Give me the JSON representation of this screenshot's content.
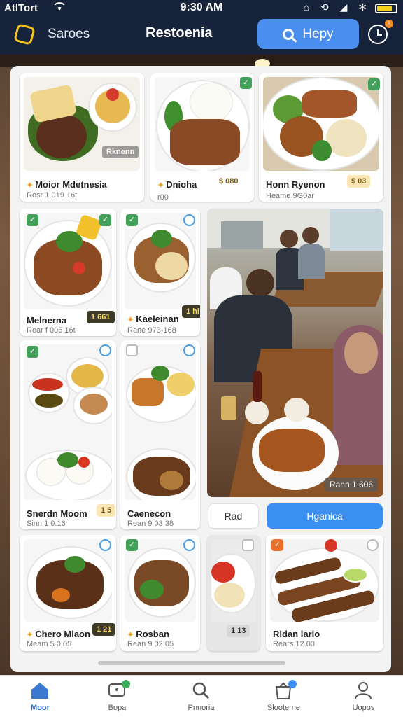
{
  "status": {
    "carrier": "AtlTort",
    "time": "9:30 AM",
    "battery_level": 0.8
  },
  "header": {
    "back_label": "Saroes",
    "title": "Restoenia",
    "help_label": "Hepy",
    "notification_count": "1"
  },
  "colors": {
    "accent": "#3b8ff0",
    "header_bg": "#17233a",
    "check_green": "#42a05a",
    "price_gold": "#f2d76b"
  },
  "cards": [
    {
      "name": "Moior Mdetnesia",
      "meta": "Rosr 1 019 16t",
      "tag": "Rknenn"
    },
    {
      "name": "Dnioha",
      "meta": "r00",
      "tag": "$ 080"
    },
    {
      "name": "Honn Ryenon",
      "meta": "Heame 9G0ar",
      "tag": "$ 03"
    },
    {
      "name": "Melnerna",
      "meta": "Rear f 005 16t",
      "tag": "1 661"
    },
    {
      "name": "Kaeleinan",
      "meta": "Rane 973-168",
      "tag": "1 hi"
    },
    {
      "name": "Snerdn Moom",
      "meta": "Sinn 1 0.16",
      "tag": "1 5"
    },
    {
      "name": "Caenecon",
      "meta": "Rean 9 03 38",
      "tag": ""
    },
    {
      "name": "Chero Mlaon",
      "meta": "Meam 5 0.05",
      "tag": "1 21"
    },
    {
      "name": "Rosban",
      "meta": "Rean 9 02.05",
      "tag": ""
    },
    {
      "name": "",
      "meta": "",
      "tag": "1 13"
    },
    {
      "name": "Rldan larlo",
      "meta": "Rears 12.00",
      "tag": ""
    }
  ],
  "scene_price": "Rann 1 606",
  "actions": {
    "add_label": "Rad",
    "reserve_label": "Hganica"
  },
  "nav": [
    {
      "label": "Moor",
      "icon": "home-icon",
      "active": true
    },
    {
      "label": "Bopa",
      "icon": "chat-icon"
    },
    {
      "label": "Pnnoria",
      "icon": "search-icon"
    },
    {
      "label": "Slooterne",
      "icon": "bag-icon"
    },
    {
      "label": "Uopos",
      "icon": "profile-icon"
    }
  ]
}
